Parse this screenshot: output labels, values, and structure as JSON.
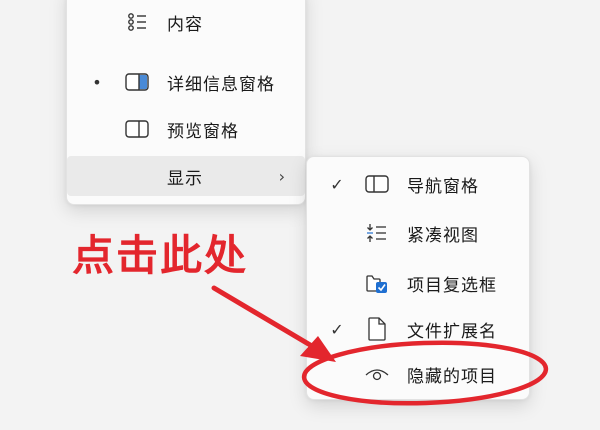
{
  "view_menu": {
    "items": [
      {
        "label": "内容",
        "icon": "content-list-icon",
        "selected": false
      },
      {
        "label": "详细信息窗格",
        "icon": "details-pane-icon",
        "selected": true,
        "mark": "•"
      },
      {
        "label": "预览窗格",
        "icon": "preview-pane-icon",
        "selected": false
      },
      {
        "label": "显示",
        "icon": "",
        "submenu": true,
        "chevron": "›"
      }
    ]
  },
  "show_submenu": {
    "items": [
      {
        "label": "导航窗格",
        "icon": "navigation-pane-icon",
        "checked": true,
        "mark": "✓"
      },
      {
        "label": "紧凑视图",
        "icon": "compact-view-icon",
        "checked": false
      },
      {
        "label": "项目复选框",
        "icon": "item-checkbox-icon",
        "checked": false
      },
      {
        "label": "文件扩展名",
        "icon": "file-extension-icon",
        "checked": true,
        "mark": "✓"
      },
      {
        "label": "隐藏的项目",
        "icon": "eye-icon",
        "checked": false
      }
    ]
  },
  "annotation": {
    "text": "点击此处",
    "color": "#e3262d",
    "arrow": "arrow-icon",
    "highlight": "ellipse-highlight"
  }
}
